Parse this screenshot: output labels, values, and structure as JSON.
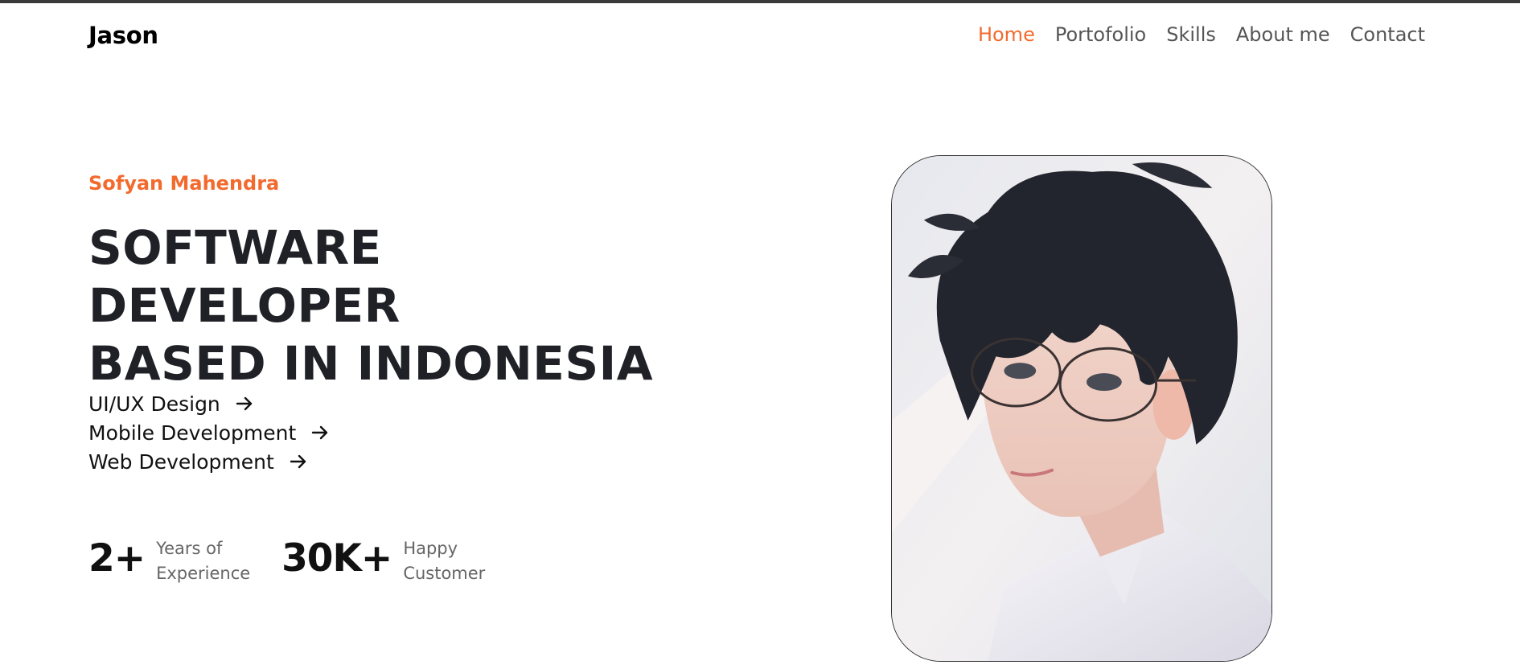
{
  "header": {
    "brand": "Jason",
    "nav": [
      {
        "label": "Home",
        "active": true
      },
      {
        "label": "Portofolio",
        "active": false
      },
      {
        "label": "Skills",
        "active": false
      },
      {
        "label": "About me",
        "active": false
      },
      {
        "label": "Contact",
        "active": false
      }
    ]
  },
  "hero": {
    "name": "Sofyan Mahendra",
    "headline_line1": "SOFTWARE DEVELOPER",
    "headline_line2": "BASED IN INDONESIA",
    "services": [
      {
        "label": "UI/UX Design",
        "icon": "arrow-right-icon"
      },
      {
        "label": "Mobile Development",
        "icon": "arrow-right-icon"
      },
      {
        "label": "Web Development",
        "icon": "arrow-right-icon"
      }
    ],
    "stats": [
      {
        "value": "2+",
        "label_line1": "Years of",
        "label_line2": "Experience"
      },
      {
        "value": "30K+",
        "label_line1": "Happy",
        "label_line2": "Customer"
      }
    ]
  },
  "colors": {
    "accent": "#f26a2e",
    "heading": "#1f2126",
    "muted": "#666666"
  }
}
